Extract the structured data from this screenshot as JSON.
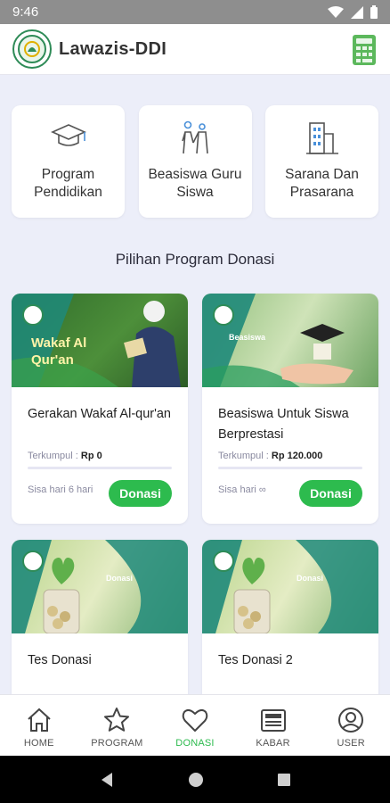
{
  "status": {
    "time": "9:46"
  },
  "app": {
    "title": "Lawazis-DDI"
  },
  "categories": [
    {
      "label": "Program Pendidikan",
      "icon": "graduation-cap-icon"
    },
    {
      "label": "Beasiswa Guru Siswa",
      "icon": "teacher-student-icon"
    },
    {
      "label": "Sarana Dan Prasarana",
      "icon": "building-icon"
    }
  ],
  "section": {
    "title": "Pilihan Program Donasi"
  },
  "programs": [
    {
      "title": "Gerakan Wakaf Al-qur'an",
      "collected_label": "Terkumpul :",
      "collected_value": "Rp 0",
      "remaining": "Sisa hari 6 hari",
      "donate_label": "Donasi",
      "banner_text": "Wakaf Al Qur'an",
      "progress": 0
    },
    {
      "title": "Beasiswa Untuk Siswa Berprestasi",
      "collected_label": "Terkumpul :",
      "collected_value": "Rp 120.000",
      "remaining": "Sisa hari ∞",
      "donate_label": "Donasi",
      "banner_text": "Beasiswa",
      "progress": 0
    },
    {
      "title": "Tes Donasi",
      "banner_text": "Donasi"
    },
    {
      "title": "Tes Donasi 2",
      "banner_text": "Donasi"
    }
  ],
  "nav": [
    {
      "label": "HOME",
      "icon": "home-icon"
    },
    {
      "label": "PROGRAM",
      "icon": "star-icon"
    },
    {
      "label": "DONASI",
      "icon": "heart-icon",
      "active": true
    },
    {
      "label": "KABAR",
      "icon": "newspaper-icon"
    },
    {
      "label": "USER",
      "icon": "user-icon"
    }
  ],
  "colors": {
    "accent": "#2dbb4e",
    "background": "#ECEEF9",
    "brand": "#2e8b57"
  }
}
